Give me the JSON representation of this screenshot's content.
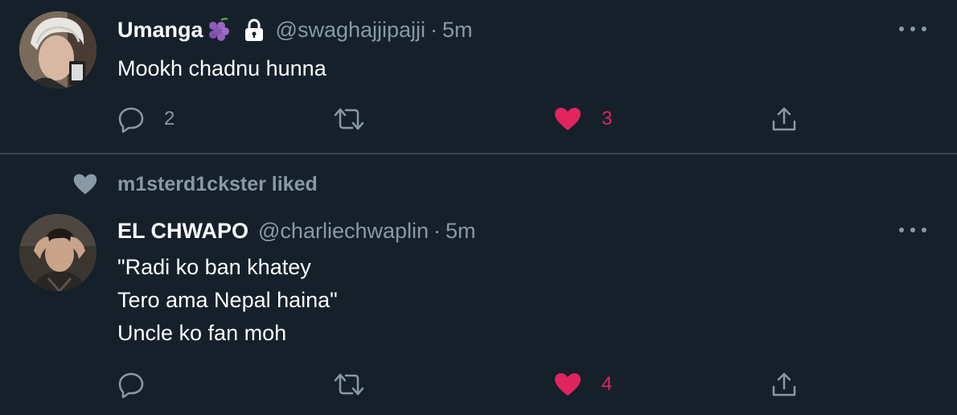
{
  "tweets": [
    {
      "display_name": "Umanga",
      "name_emoji": "grapes-emoji",
      "locked_icon": "lock-icon",
      "handle": "@swaghajjipajji",
      "separator": "·",
      "time": "5m",
      "text_lines": [
        "Mookh chadnu hunna"
      ],
      "reply_count": "2",
      "retweet_count": "",
      "like_count": "3",
      "liked": true
    },
    {
      "social_context": "m1sterd1ckster liked",
      "display_name": "EL CHWAPO",
      "handle": "@charliechwaplin",
      "separator": "·",
      "time": "5m",
      "text_lines": [
        "\"Radi ko ban khatey",
        "Tero ama Nepal haina\"",
        "Uncle ko fan moh"
      ],
      "reply_count": "",
      "retweet_count": "",
      "like_count": "4",
      "liked": true
    }
  ],
  "icons": {
    "reply": "reply-icon",
    "retweet": "retweet-icon",
    "like": "heart-icon",
    "share": "share-icon",
    "more": "more-icon"
  },
  "colors": {
    "background": "#15202b",
    "secondary_text": "#8899a6",
    "like_accent": "#e0245e",
    "divider": "#38444d"
  }
}
